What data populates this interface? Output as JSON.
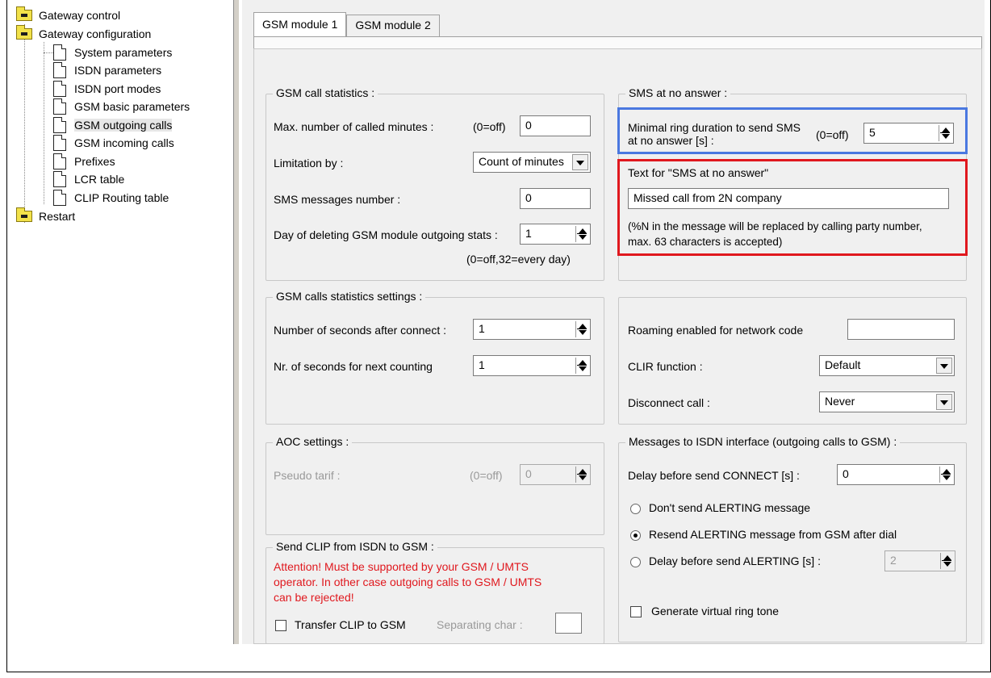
{
  "tree": {
    "gateway_control": "Gateway control",
    "gateway_configuration": "Gateway configuration",
    "items": [
      "System parameters",
      "ISDN parameters",
      "ISDN port modes",
      "GSM basic parameters",
      "GSM outgoing calls",
      "GSM incoming calls",
      "Prefixes",
      "LCR table",
      "CLIP Routing table"
    ],
    "restart": "Restart",
    "selected": "GSM outgoing calls"
  },
  "tabs": [
    "GSM module 1",
    "GSM module 2"
  ],
  "call_stats": {
    "title": "GSM call statistics :",
    "max_minutes_label": "Max. number of called minutes :",
    "max_minutes_hint": "(0=off)",
    "max_minutes_value": "0",
    "limitation_label": "Limitation by :",
    "limitation_value": "Count of minutes",
    "sms_number_label": "SMS messages number :",
    "sms_number_value": "0",
    "day_delete_label": "Day of deleting GSM module outgoing stats :",
    "day_delete_value": "1",
    "day_delete_hint": "(0=off,32=every day)"
  },
  "sms_no_answer": {
    "title": "SMS at no answer :",
    "min_ring_label_1": "Minimal ring duration to send SMS",
    "min_ring_label_2": "at no answer [s] :",
    "min_ring_hint": "(0=off)",
    "min_ring_value": "5",
    "text_label": "Text for \"SMS at no answer\"",
    "text_value": "Missed call from 2N company",
    "note_1": "(%N in the message will be replaced by calling party number,",
    "note_2": "max. 63 characters is accepted)"
  },
  "stats_settings": {
    "title": "GSM calls statistics settings :",
    "seconds_after_label": "Number of seconds after connect :",
    "seconds_after_value": "1",
    "next_counting_label": "Nr. of seconds for next counting",
    "next_counting_value": "1"
  },
  "roaming": {
    "roaming_label": "Roaming enabled for network code",
    "roaming_value": "",
    "clir_label": "CLIR function :",
    "clir_value": "Default",
    "disconnect_label": "Disconnect call :",
    "disconnect_value": "Never"
  },
  "aoc": {
    "title": "AOC settings :",
    "pseudo_label": "Pseudo tarif :",
    "pseudo_hint": "(0=off)",
    "pseudo_value": "0"
  },
  "isdn_messages": {
    "title": "Messages to ISDN interface (outgoing calls to GSM) :",
    "delay_connect_label": "Delay before send CONNECT [s] :",
    "delay_connect_value": "0",
    "radio_dont_send": "Don't send ALERTING message",
    "radio_resend": "Resend ALERTING message from GSM after dial",
    "radio_delay": "Delay before send ALERTING [s] :",
    "delay_alerting_value": "2",
    "selected_radio": "Resend ALERTING message from GSM after dial",
    "virtual_ring_label": "Generate virtual ring tone",
    "virtual_ring_checked": false
  },
  "send_clip": {
    "title": "Send CLIP from ISDN to GSM :",
    "warning_1": "Attention! Must be supported by your GSM / UMTS",
    "warning_2": "operator. In other case outgoing calls to GSM / UMTS",
    "warning_3": "can be rejected!",
    "transfer_label": "Transfer CLIP to GSM",
    "transfer_checked": false,
    "separating_label": "Separating char :",
    "separating_value": ""
  },
  "colors": {
    "highlight_blue": "#4a78e0",
    "highlight_red": "#e0181e",
    "warning_text": "#e0181e"
  }
}
